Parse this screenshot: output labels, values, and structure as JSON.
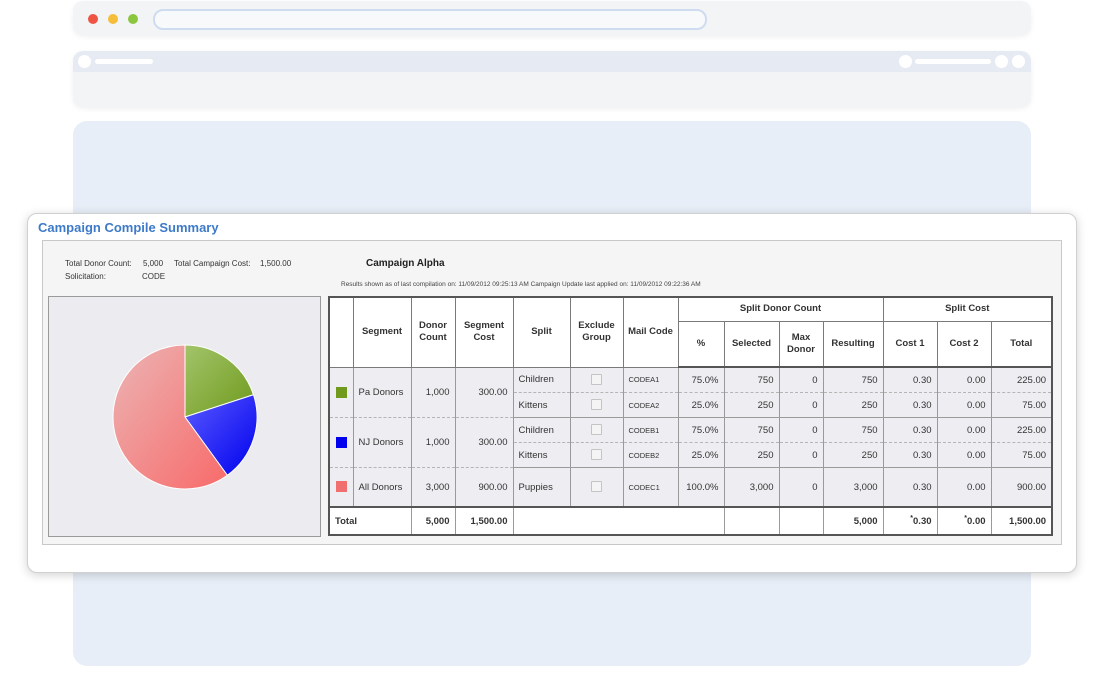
{
  "summary": {
    "title": "Campaign Compile Summary",
    "total_donor_count_label": "Total Donor Count:",
    "total_donor_count": "5,000",
    "total_campaign_cost_label": "Total Campaign Cost:",
    "total_campaign_cost": "1,500.00",
    "solicitation_label": "Solicitation:",
    "solicitation": "CODE",
    "campaign_name": "Campaign Alpha",
    "results_line": "Results shown as of last compilation on:  11/09/2012 09:25:13 AM     Campaign Update last applied on:  11/09/2012 09:22:36 AM"
  },
  "colors": {
    "accent": "#3d7ac8",
    "pa_donors": "#6f9a1c",
    "nj_donors": "#0000ee",
    "all_donors": "#f07070"
  },
  "table": {
    "headers": {
      "segment": "Segment",
      "donor_count": "Donor Count",
      "segment_cost": "Segment Cost",
      "split": "Split",
      "exclude_group": "Exclude Group",
      "mail_code": "Mail Code",
      "split_donor_count": "Split Donor Count",
      "split_cost": "Split Cost",
      "pct": "%",
      "selected": "Selected",
      "max_donor": "Max Donor",
      "resulting": "Resulting",
      "cost1": "Cost 1",
      "cost2": "Cost 2",
      "total": "Total"
    },
    "segments": [
      {
        "name": "Pa Donors",
        "donor_count": "1,000",
        "segment_cost": "300.00",
        "splits": [
          {
            "split": "Children",
            "mail_code": "CODEA1",
            "pct": "75.0%",
            "selected": "750",
            "max_donor": "0",
            "resulting": "750",
            "cost1": "0.30",
            "cost2": "0.00",
            "total": "225.00"
          },
          {
            "split": "Kittens",
            "mail_code": "CODEA2",
            "pct": "25.0%",
            "selected": "250",
            "max_donor": "0",
            "resulting": "250",
            "cost1": "0.30",
            "cost2": "0.00",
            "total": "75.00"
          }
        ]
      },
      {
        "name": "NJ Donors",
        "donor_count": "1,000",
        "segment_cost": "300.00",
        "splits": [
          {
            "split": "Children",
            "mail_code": "CODEB1",
            "pct": "75.0%",
            "selected": "750",
            "max_donor": "0",
            "resulting": "750",
            "cost1": "0.30",
            "cost2": "0.00",
            "total": "225.00"
          },
          {
            "split": "Kittens",
            "mail_code": "CODEB2",
            "pct": "25.0%",
            "selected": "250",
            "max_donor": "0",
            "resulting": "250",
            "cost1": "0.30",
            "cost2": "0.00",
            "total": "75.00"
          }
        ]
      },
      {
        "name": "All Donors",
        "donor_count": "3,000",
        "segment_cost": "900.00",
        "splits": [
          {
            "split": "Puppies",
            "mail_code": "CODEC1",
            "pct": "100.0%",
            "selected": "3,000",
            "max_donor": "0",
            "resulting": "3,000",
            "cost1": "0.30",
            "cost2": "0.00",
            "total": "900.00"
          }
        ]
      }
    ],
    "totals": {
      "label": "Total",
      "donor_count": "5,000",
      "segment_cost": "1,500.00",
      "resulting": "5,000",
      "cost1_marker": "*",
      "cost1": "0.30",
      "cost2_marker": "*",
      "cost2": "0.00",
      "total": "1,500.00"
    }
  },
  "chart_data": {
    "type": "pie",
    "categories": [
      "Pa Donors",
      "NJ Donors",
      "All Donors"
    ],
    "values": [
      1000,
      1000,
      3000
    ],
    "colors": [
      "#6f9a1c",
      "#0000ee",
      "#f07070"
    ],
    "title": ""
  }
}
